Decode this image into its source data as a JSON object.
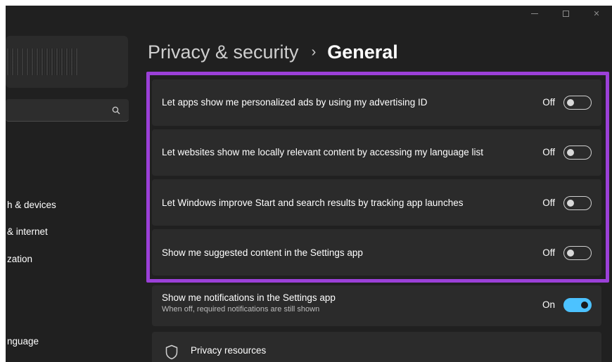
{
  "window": {
    "controls": {
      "minimize": "minimize-icon",
      "maximize": "maximize-icon",
      "close": "close-icon",
      "close_glyph": "✕"
    }
  },
  "sidebar": {
    "search_icon": "search-icon",
    "items": [
      {
        "label": "h & devices"
      },
      {
        "label": "& internet"
      },
      {
        "label": "zation"
      },
      {
        "label": "nguage"
      }
    ]
  },
  "header": {
    "breadcrumb_parent": "Privacy & security",
    "breadcrumb_separator": "›",
    "breadcrumb_current": "General"
  },
  "settings": [
    {
      "label": "Let apps show me personalized ads by using my advertising ID",
      "state": "Off",
      "on": false
    },
    {
      "label": "Let websites show me locally relevant content by accessing my language list",
      "state": "Off",
      "on": false
    },
    {
      "label": "Let Windows improve Start and search results by tracking app launches",
      "state": "Off",
      "on": false
    },
    {
      "label": "Show me suggested content in the Settings app",
      "state": "Off",
      "on": false
    },
    {
      "label": "Show me notifications in the Settings app",
      "sublabel": "When off, required notifications are still shown",
      "state": "On",
      "on": true
    }
  ],
  "privacy_resources": {
    "label": "Privacy resources",
    "icon": "shield-icon"
  },
  "colors": {
    "window_bg": "#202020",
    "card_bg": "#2b2b2b",
    "highlight_border": "#9b40d8",
    "toggle_on": "#4cc2ff"
  }
}
